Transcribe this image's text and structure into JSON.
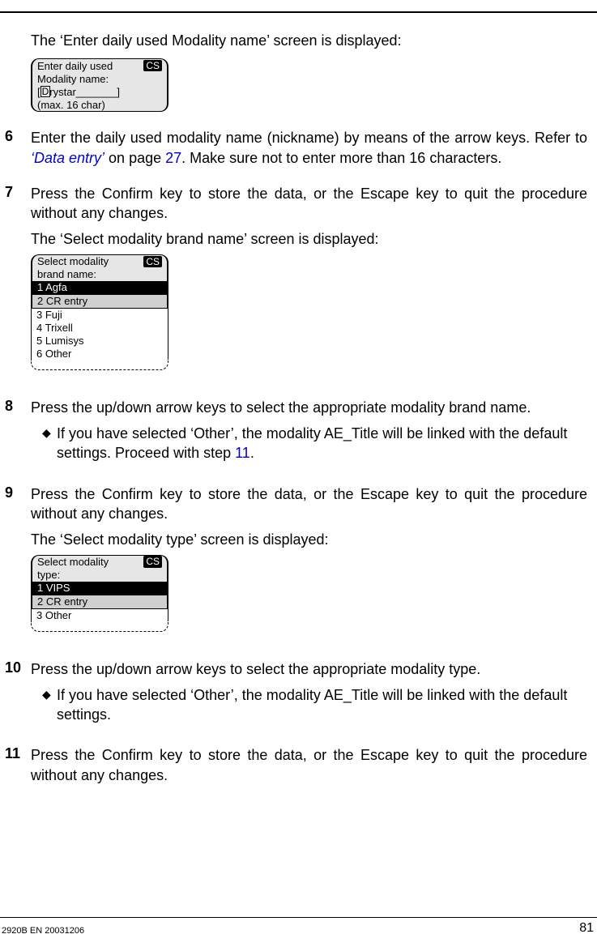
{
  "intro1": "The ‘Enter daily used Modality name’ screen is displayed:",
  "lcd1": {
    "line1a": "Enter daily used",
    "cs": "CS",
    "line2": "Modality name:",
    "line3_prefix": "[",
    "line3_cursor": "D",
    "line3_rest": "rystar_______]",
    "line4": "(max. 16 char)"
  },
  "step6": {
    "num": "6",
    "text_a": "Enter the daily used modality name (nickname) by means of the arrow keys. Refer to ",
    "link1": "‘Data entry’",
    "mid": " on page ",
    "link2": "27",
    "text_b": ". Make sure not to enter more than 16 characters."
  },
  "step7": {
    "num": "7",
    "para1": "Press the Confirm key to store the data, or the Escape key to quit the procedure without any changes.",
    "para2": "The ‘Select modality brand name’ screen is displayed:"
  },
  "lcd2": {
    "line1a": "Select modality",
    "cs": "CS",
    "line2": "brand name:",
    "opt1": "1 Agfa",
    "opt2": "2 CR entry",
    "opt3": "3 Fuji",
    "opt4": "4 Trixell",
    "opt5": "5 Lumisys",
    "opt6": "6 Other"
  },
  "step8": {
    "num": "8",
    "para": "Press the up/down arrow keys to select the appropriate modality brand name.",
    "bullet_a": "If you have selected ‘Other’, the modality AE_Title will be linked with the default settings. Proceed with step ",
    "bullet_link": "11",
    "bullet_b": "."
  },
  "step9": {
    "num": "9",
    "para1": "Press the Confirm key to store the data, or the Escape key to quit the procedure without any changes.",
    "para2": "The ‘Select modality type’ screen is displayed:"
  },
  "lcd3": {
    "line1a": "Select modality",
    "cs": "CS",
    "line2": "type:",
    "opt1": "1 VIPS",
    "opt2": "2 CR entry",
    "opt3": "3 Other"
  },
  "step10": {
    "num": "10",
    "para": "Press the up/down arrow keys to select the appropriate modality type.",
    "bullet": "If you have selected ‘Other’, the modality AE_Title will be linked with the default settings."
  },
  "step11": {
    "num": "11",
    "para": "Press the Confirm key to store the data, or the Escape key to quit the procedure without any changes."
  },
  "footer_left": "2920B EN 20031206",
  "footer_right": "81"
}
